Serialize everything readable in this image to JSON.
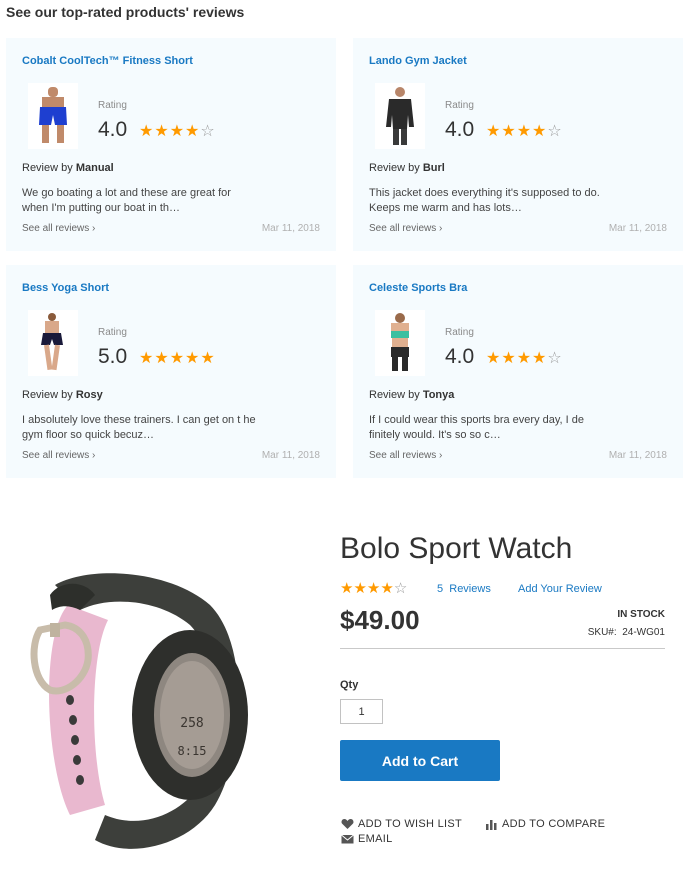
{
  "reviews_section": {
    "heading": "See our top-rated products' reviews",
    "rating_label": "Rating",
    "review_by_prefix": "Review by",
    "see_all_label": "See all reviews",
    "cards": [
      {
        "product": "Cobalt CoolTech™ Fitness Short",
        "rating": "4.0",
        "stars": 4,
        "reviewer": "Manual",
        "text": "We go boating a lot and these are great for when I'm putting our boat in th…",
        "date": "Mar 11, 2018"
      },
      {
        "product": "Lando Gym Jacket",
        "rating": "4.0",
        "stars": 4,
        "reviewer": "Burl",
        "text": "This jacket does everything it's supposed to do. Keeps me warm and has lots…",
        "date": "Mar 11, 2018"
      },
      {
        "product": "Bess Yoga Short",
        "rating": "5.0",
        "stars": 5,
        "reviewer": "Rosy",
        "text": "I absolutely love these trainers. I can get on t he gym floor so quick becuz…",
        "date": "Mar 11, 2018"
      },
      {
        "product": "Celeste Sports Bra",
        "rating": "4.0",
        "stars": 4,
        "reviewer": "Tonya",
        "text": "If I could wear this sports bra every day, I de finitely would. It's so so c…",
        "date": "Mar 11, 2018"
      }
    ]
  },
  "product": {
    "title": "Bolo Sport Watch",
    "stars": 4,
    "reviews_count": "5",
    "reviews_label": "Reviews",
    "add_review_label": "Add Your Review",
    "price": "$49.00",
    "stock_status": "IN STOCK",
    "sku_label": "SKU#:",
    "sku": "24-WG01",
    "qty_label": "Qty",
    "qty_value": "1",
    "add_to_cart_label": "Add to Cart",
    "wishlist_label": "ADD TO WISH LIST",
    "compare_label": "ADD TO COMPARE",
    "email_label": "EMAIL",
    "watch_display_top": "258",
    "watch_display_bottom": "8:15"
  },
  "colors": {
    "link": "#1979c3",
    "star": "#ff9a00",
    "card_bg": "#f5fbfe",
    "button": "#1979c3"
  }
}
